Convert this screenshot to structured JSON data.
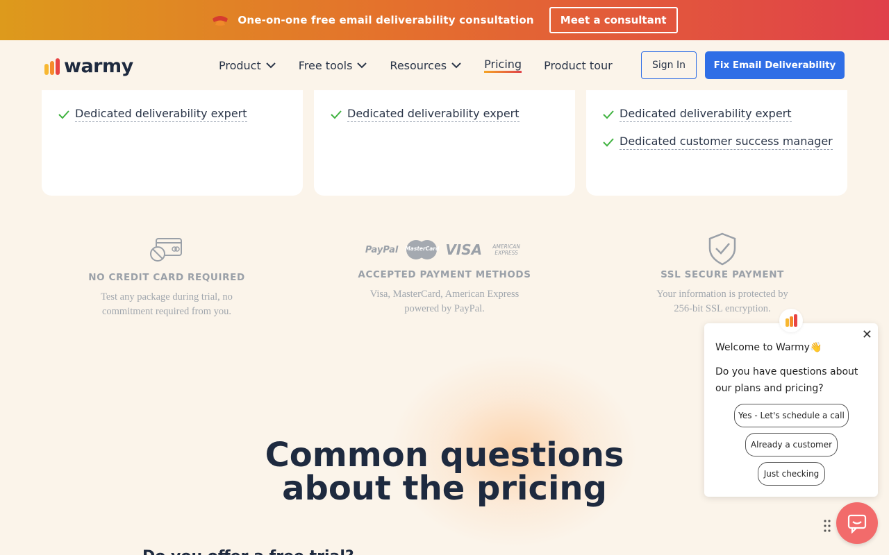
{
  "colors": {
    "promo_start": "#dd9a1c",
    "promo_end": "#e0404a",
    "primary_blue": "#2f6ee6",
    "check_green": "#3fb23f",
    "navy": "#1e2a3f",
    "background": "#fbf4ea",
    "chat_launcher": "#f26b6b"
  },
  "promo": {
    "icon": "phone-icon",
    "text": "One-on-one free email deliverability consultation",
    "button_label": "Meet a consultant"
  },
  "nav": {
    "logo_text": "warmy",
    "items": [
      {
        "label": "Product",
        "dropdown": true
      },
      {
        "label": "Free tools",
        "dropdown": true
      },
      {
        "label": "Resources",
        "dropdown": true
      },
      {
        "label": "Pricing",
        "dropdown": false,
        "active": true
      },
      {
        "label": "Product tour",
        "dropdown": false
      }
    ],
    "sign_in": "Sign In",
    "cta": "Fix Email Deliverability"
  },
  "plans": [
    {
      "features": [
        "Dedicated deliverability expert"
      ]
    },
    {
      "features": [
        "Dedicated deliverability expert"
      ]
    },
    {
      "features": [
        "Dedicated deliverability expert",
        "Dedicated customer success manager"
      ]
    }
  ],
  "trust": [
    {
      "icon": "no-credit-card-icon",
      "title": "NO CREDIT CARD REQUIRED",
      "line1": "Test any package during trial, no",
      "line2": "commitment required from you."
    },
    {
      "icon": "payment-logos-icon",
      "title": "ACCEPTED PAYMENT METHODS",
      "line1": "Visa, MasterCard, American Express",
      "line2": "powered by PayPal.",
      "logos": [
        "PayPal",
        "MasterCard",
        "VISA",
        "AMERICAN EXPRESS"
      ]
    },
    {
      "icon": "shield-check-icon",
      "title": "SSL SECURE PAYMENT",
      "line1": "Your information is protected by",
      "line2": "256-bit SSL encryption."
    }
  ],
  "faq": {
    "title_line1": "Common questions",
    "title_line2": "about the pricing",
    "first_question": "Do you offer a free trial?"
  },
  "chat": {
    "welcome": "Welcome to Warmy👋",
    "question": "Do you have questions about our plans and pricing?",
    "options": [
      "Yes - Let's schedule a call",
      "Already a customer",
      "Just checking"
    ],
    "close": "✕"
  }
}
